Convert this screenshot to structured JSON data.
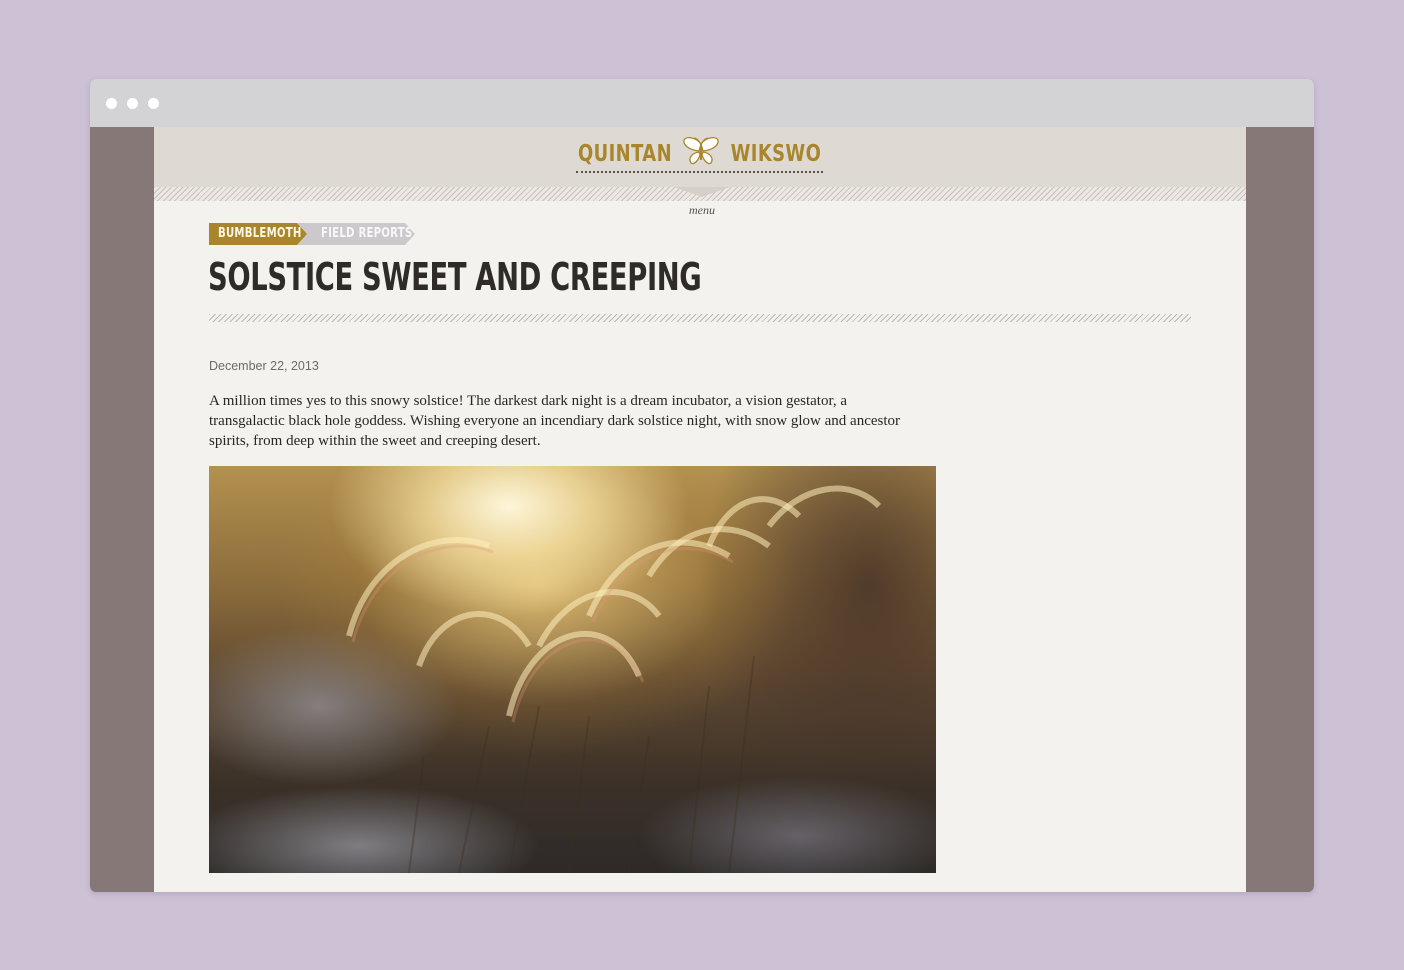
{
  "site": {
    "name_left": "QUINTAN",
    "name_right": "WIKSWO",
    "menu_label": "menu"
  },
  "breadcrumb": {
    "items": [
      "BUMBLEMOTH",
      "FIELD REPORTS"
    ]
  },
  "post": {
    "title": "SOLSTICE SWEET AND CREEPING",
    "date": "December 22, 2013",
    "body": "A million times yes to this snowy solstice! The darkest dark night is a dream incubator, a vision gestator, a transgalactic black hole goddess. Wishing everyone an incendiary dark solstice night, with snow glow and ancestor spirits, from deep within the sweet and creeping desert."
  },
  "colors": {
    "page_background": "#cdc1d6",
    "accent_gold": "#a9862b",
    "sidebar_taupe": "#867876",
    "crumb_grey": "#cbc9cb",
    "title_dark": "#2f2c28"
  },
  "icons": {
    "logo_emblem": "moth-icon",
    "window_controls": "dot-icons"
  }
}
